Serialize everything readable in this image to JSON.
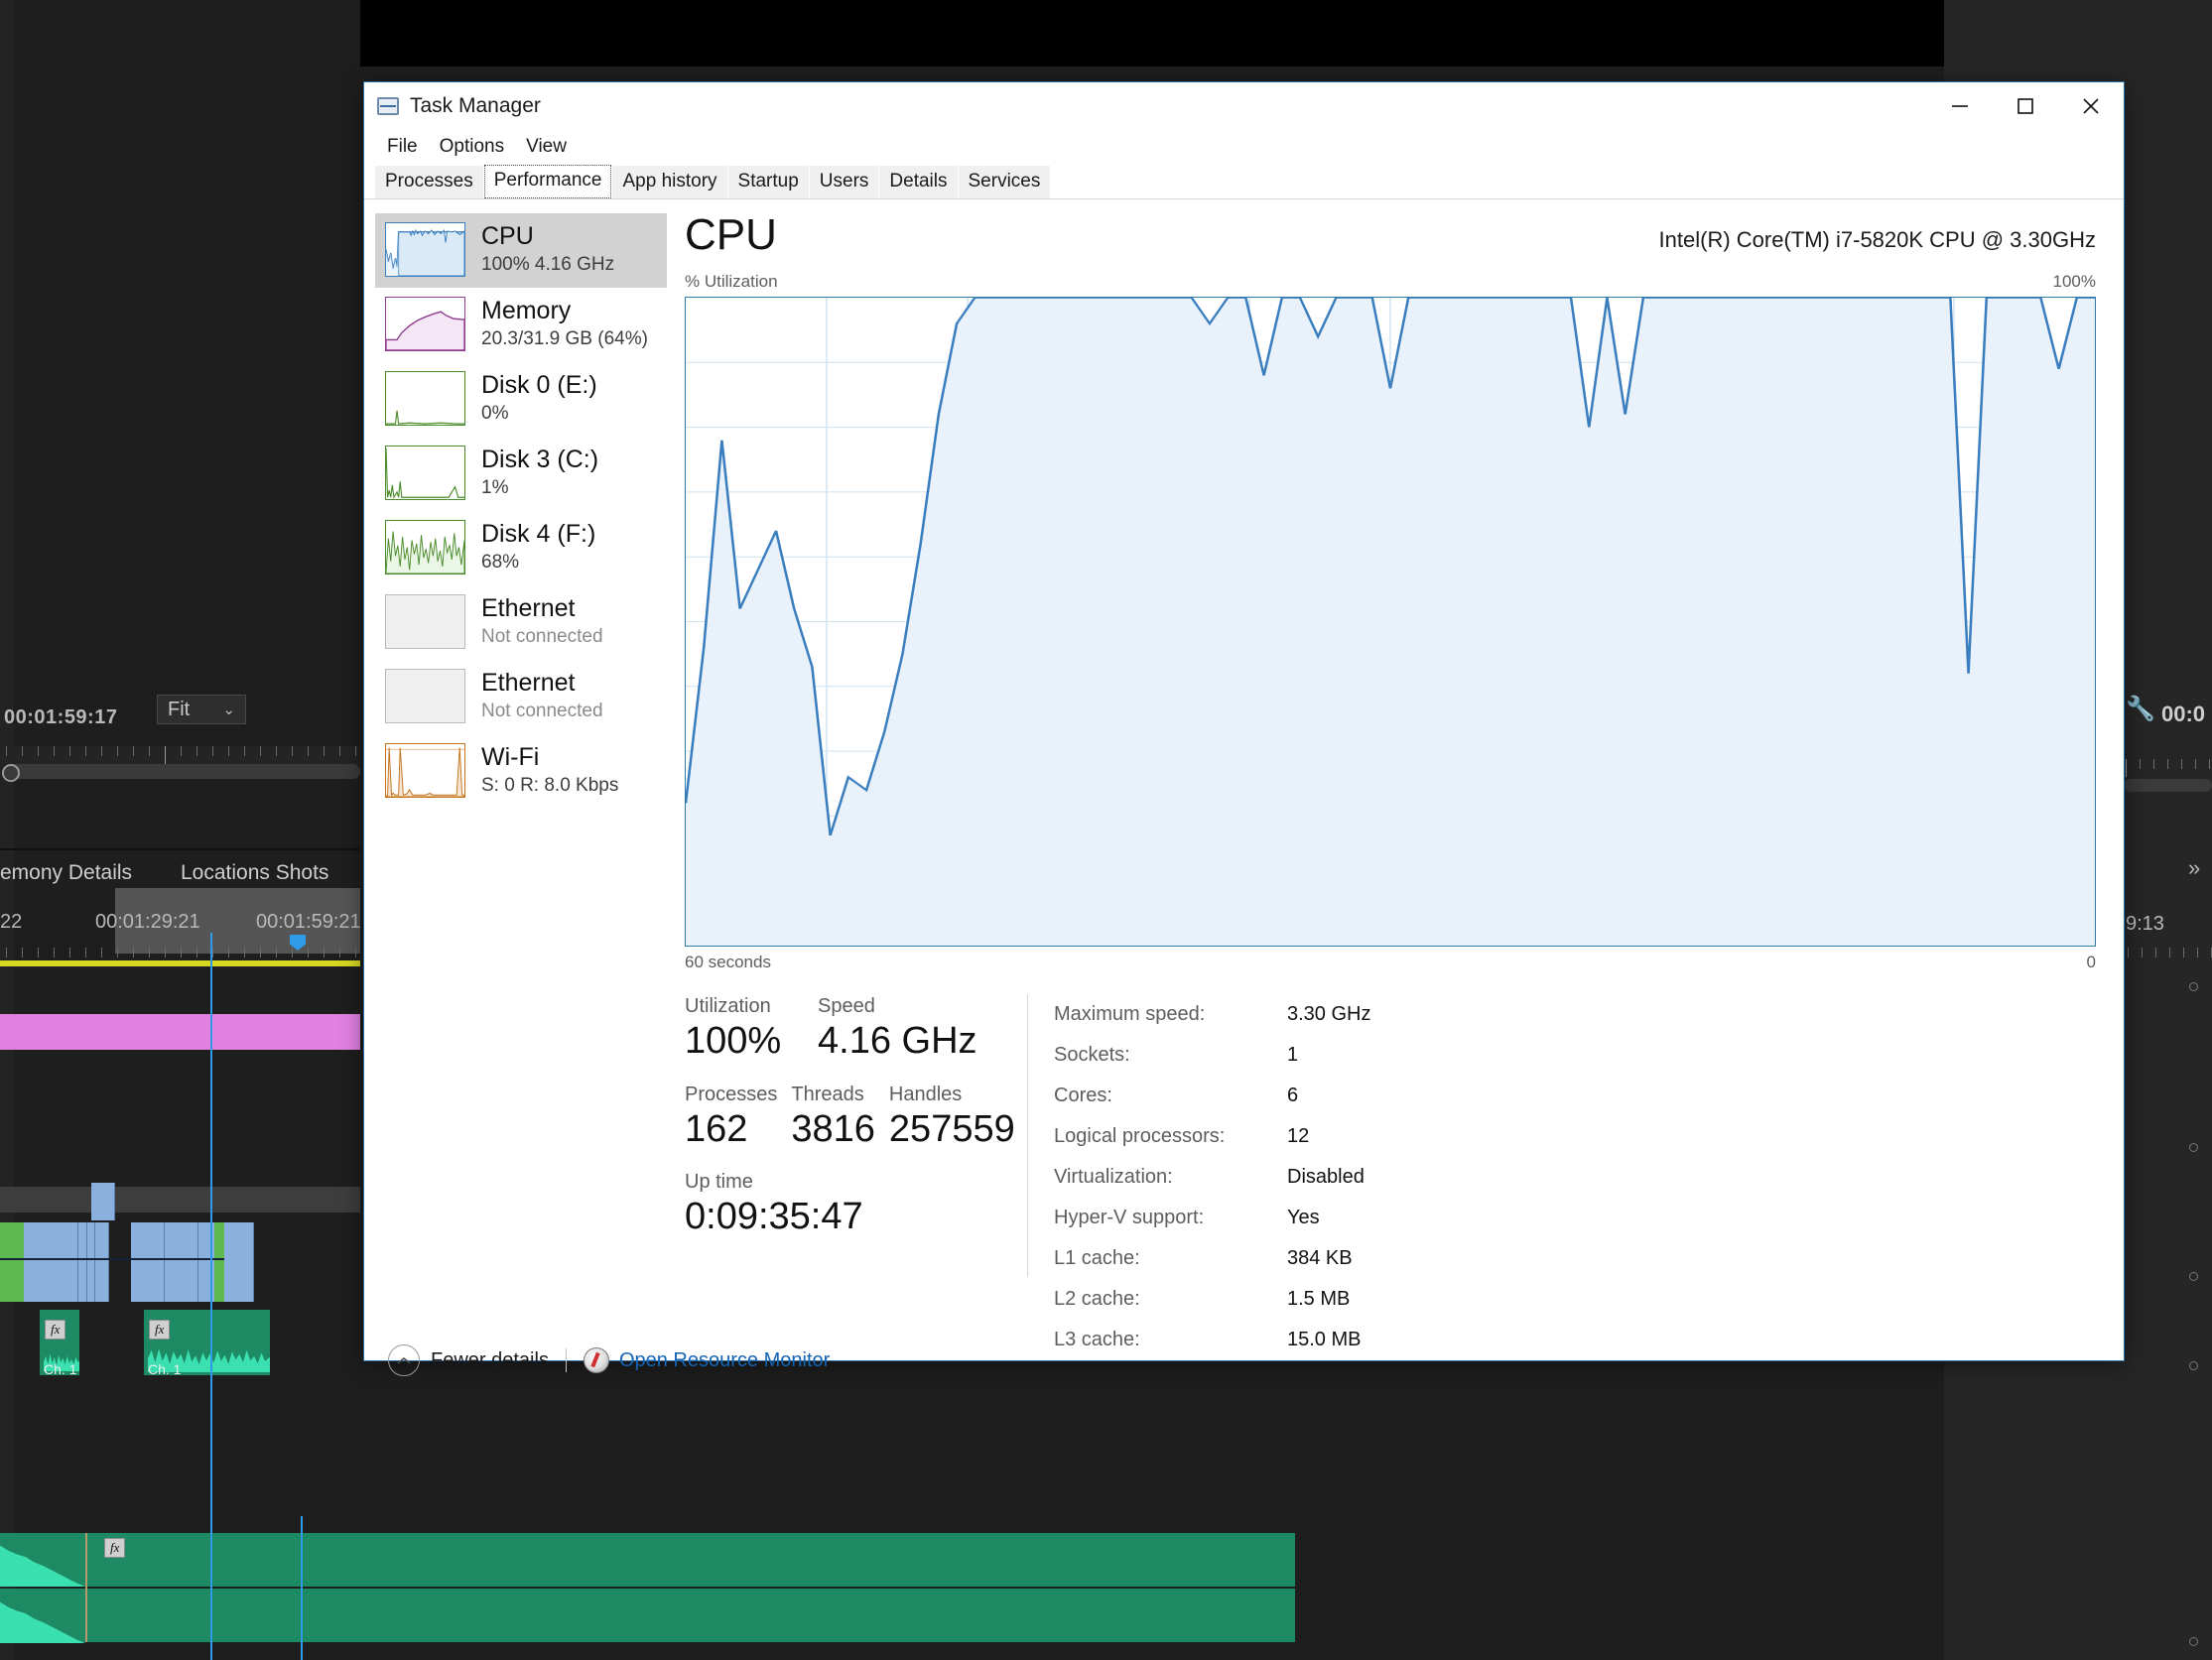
{
  "window": {
    "title": "Task Manager",
    "icon": "task-manager-icon",
    "buttons": {
      "minimize": "—",
      "maximize": "□",
      "close": "✕"
    }
  },
  "menu": {
    "items": [
      "File",
      "Options",
      "View"
    ]
  },
  "tabs": {
    "items": [
      "Processes",
      "Performance",
      "App history",
      "Startup",
      "Users",
      "Details",
      "Services"
    ],
    "active": "Performance"
  },
  "sidebar": {
    "items": [
      {
        "name": "CPU",
        "title": "CPU",
        "sub": "100%  4.16 GHz",
        "selected": true,
        "color": "#3a7ebf",
        "thumb": "cpu-thumbnail"
      },
      {
        "name": "Memory",
        "title": "Memory",
        "sub": "20.3/31.9 GB (64%)",
        "selected": false,
        "color": "#8e3a8e",
        "thumb": "memory-thumbnail"
      },
      {
        "name": "Disk 0 (E:)",
        "title": "Disk 0 (E:)",
        "sub": "0%",
        "selected": false,
        "color": "#4a8c2a",
        "thumb": "disk0-thumbnail"
      },
      {
        "name": "Disk 3 (C:)",
        "title": "Disk 3 (C:)",
        "sub": "1%",
        "selected": false,
        "color": "#4a8c2a",
        "thumb": "disk3-thumbnail"
      },
      {
        "name": "Disk 4 (F:)",
        "title": "Disk 4 (F:)",
        "sub": "68%",
        "selected": false,
        "color": "#4a8c2a",
        "thumb": "disk4-thumbnail"
      },
      {
        "name": "Ethernet 1",
        "title": "Ethernet",
        "sub": "Not connected",
        "selected": false,
        "color": "#bcbcbc",
        "thumb": "ethernet-thumbnail",
        "dim": true
      },
      {
        "name": "Ethernet 2",
        "title": "Ethernet",
        "sub": "Not connected",
        "selected": false,
        "color": "#bcbcbc",
        "thumb": "ethernet-thumbnail",
        "dim": true
      },
      {
        "name": "Wi-Fi",
        "title": "Wi-Fi",
        "sub": "S: 0 R: 8.0 Kbps",
        "selected": false,
        "color": "#c4731a",
        "thumb": "wifi-thumbnail"
      }
    ]
  },
  "detail": {
    "title": "CPU",
    "model": "Intel(R) Core(TM) i7-5820K CPU @ 3.30GHz",
    "axis_label": "% Utilization",
    "axis_max": "100%",
    "time_left": "60 seconds",
    "time_right": "0",
    "stats": [
      {
        "label": "Utilization",
        "value": "100%"
      },
      {
        "label": "Speed",
        "value": "4.16 GHz"
      },
      {
        "label": "Processes",
        "value": "162"
      },
      {
        "label": "Threads",
        "value": "3816"
      },
      {
        "label": "Handles",
        "value": "257559"
      },
      {
        "label": "Up time",
        "value": "0:09:35:47"
      }
    ],
    "info": [
      {
        "key": "Maximum speed:",
        "value": "3.30 GHz"
      },
      {
        "key": "Sockets:",
        "value": "1"
      },
      {
        "key": "Cores:",
        "value": "6"
      },
      {
        "key": "Logical processors:",
        "value": "12"
      },
      {
        "key": "Virtualization:",
        "value": "Disabled"
      },
      {
        "key": "Hyper-V support:",
        "value": "Yes"
      },
      {
        "key": "L1 cache:",
        "value": "384 KB"
      },
      {
        "key": "L2 cache:",
        "value": "1.5 MB"
      },
      {
        "key": "L3 cache:",
        "value": "15.0 MB"
      }
    ]
  },
  "footer": {
    "fewer_details": "Fewer details",
    "fewer_details_pre": "Fewer ",
    "fewer_details_key": "d",
    "fewer_details_post": "etails",
    "resource_monitor": "Open Resource Monitor",
    "chevron": "∧"
  },
  "chart_data": {
    "type": "area",
    "title": "CPU % Utilization",
    "xlabel": "",
    "ylabel": "% Utilization",
    "ylim": [
      0,
      100
    ],
    "xlim": [
      60,
      0
    ],
    "x_tick_labels": [
      "60 seconds",
      "0"
    ],
    "grid": true,
    "line_color": "#3a7ebf",
    "fill_color": "#e9f2fa",
    "series": [
      {
        "name": "CPU utilization",
        "values": [
          22,
          46,
          78,
          52,
          58,
          64,
          52,
          43,
          17,
          26,
          24,
          33,
          45,
          62,
          82,
          96,
          100,
          100,
          100,
          100,
          100,
          100,
          100,
          100,
          100,
          100,
          100,
          100,
          100,
          96,
          100,
          100,
          88,
          100,
          100,
          94,
          100,
          100,
          100,
          86,
          100,
          100,
          100,
          100,
          100,
          100,
          100,
          100,
          100,
          100,
          80,
          100,
          82,
          100,
          100,
          100,
          100,
          100,
          100,
          100,
          100,
          100,
          100,
          100,
          100,
          100,
          100,
          100,
          100,
          100,
          100,
          42,
          100,
          100,
          100,
          100,
          89,
          100,
          100
        ]
      }
    ]
  },
  "background": {
    "app": "video-editor",
    "timecode_main": "00:01:59:17",
    "zoom_select": "Fit",
    "zoom_chevron": "⌄",
    "tab_labels": [
      "emony Details",
      "Locations Shots"
    ],
    "ruler_labels": [
      "22",
      "00:01:29:21",
      "00:01:59:21"
    ],
    "right_timecode": "00:0",
    "right_ruler_label": "9:13",
    "right_arrow": "»",
    "clip_channel_label": "Ch. 1",
    "fx_label": "fx",
    "wrench_icon": "wrench-icon"
  }
}
